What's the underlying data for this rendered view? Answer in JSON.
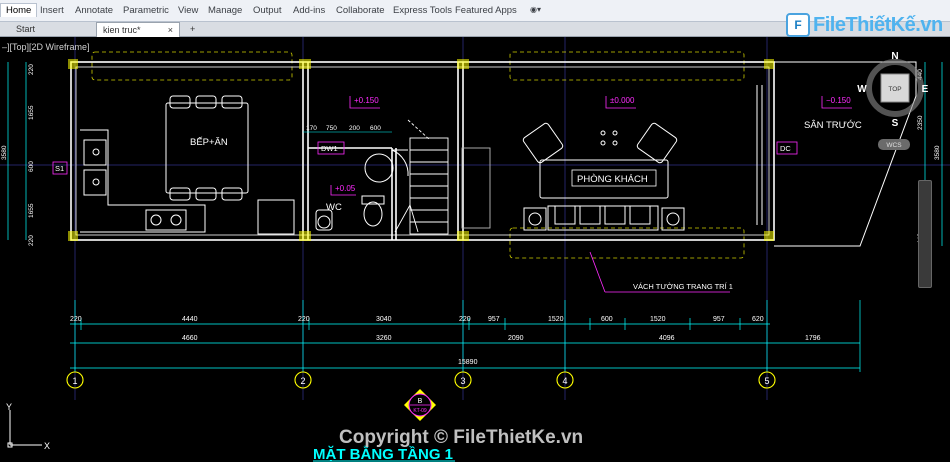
{
  "ribbon": {
    "tabs": [
      "Home",
      "Insert",
      "Annotate",
      "Parametric",
      "View",
      "Manage",
      "Output",
      "Add-ins",
      "Collaborate",
      "Express Tools",
      "Featured Apps"
    ],
    "active_tab": "Home"
  },
  "doc_tabs": {
    "start": "Start",
    "file": "kien truc*",
    "close": "×",
    "add": "+"
  },
  "viewport_label": "–][Top][2D Wireframe]",
  "logo": {
    "text": "FileThiếtKế.vn",
    "mark": "F"
  },
  "viewcube": {
    "n": "N",
    "s": "S",
    "e": "E",
    "w": "W",
    "top": "TOP",
    "wcs": "WCS"
  },
  "rooms": {
    "kitchen": "BẾP+ĂN",
    "wc": "WC",
    "living": "PHÒNG KHÁCH",
    "front_yard": "SÂN TRƯỚC"
  },
  "tags": {
    "dw1": "DW1",
    "dc": "DC",
    "s1": "S1",
    "wall_note": "VÁCH TƯỜNG TRANG TRÍ 1"
  },
  "levels": {
    "l1": "+0.150",
    "l2": "±0.000",
    "l3": "−0.150",
    "l4": "+0.05"
  },
  "small_dims": [
    "170",
    "750",
    "200",
    "600"
  ],
  "dims_row1": [
    "220",
    "4440",
    "220",
    "3040",
    "220",
    "957",
    "1520",
    "600",
    "1520",
    "957",
    "620"
  ],
  "dims_row2": [
    "4660",
    "3260",
    "2090",
    "4096",
    "1796"
  ],
  "dims_total": "15890",
  "left_dims": [
    "220",
    "1655",
    "3580",
    "600",
    "1655",
    "220"
  ],
  "right_dims": [
    "440",
    "3580",
    "2350",
    "440"
  ],
  "axes": [
    "1",
    "2",
    "3",
    "4",
    "5"
  ],
  "section_marker": {
    "letter": "B",
    "ref": "KT-09"
  },
  "ucs": {
    "x": "X",
    "y": "Y"
  },
  "title": "MẶT BẰNG TẦNG 1",
  "watermark": "Copyright © FileThietKe.vn",
  "colors": {
    "wall": "#ffffff",
    "dim": "#00ffff",
    "level": "#ff2bff",
    "axis": "#ffff00",
    "hatch": "#ffff00",
    "grid": "#3a3a8a",
    "accent": "#4fb3ef"
  }
}
